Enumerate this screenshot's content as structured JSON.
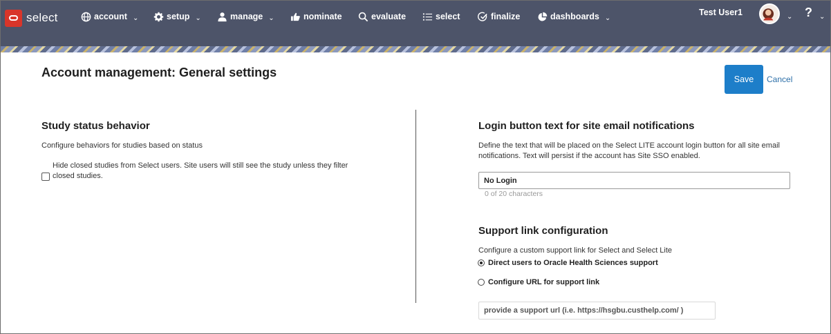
{
  "app": {
    "name": "select",
    "logo_icon": "oracle-logo-icon"
  },
  "nav": {
    "items": [
      {
        "key": "account",
        "label": "account",
        "icon": "globe-icon",
        "dropdown": true
      },
      {
        "key": "setup",
        "label": "setup",
        "icon": "gear-icon",
        "dropdown": true
      },
      {
        "key": "manage",
        "label": "manage",
        "icon": "person-icon",
        "dropdown": true
      },
      {
        "key": "nominate",
        "label": "nominate",
        "icon": "thumbs-up-icon",
        "dropdown": false
      },
      {
        "key": "evaluate",
        "label": "evaluate",
        "icon": "search-icon",
        "dropdown": false
      },
      {
        "key": "select",
        "label": "select",
        "icon": "list-icon",
        "dropdown": false
      },
      {
        "key": "finalize",
        "label": "finalize",
        "icon": "check-circle-icon",
        "dropdown": false
      },
      {
        "key": "dashboards",
        "label": "dashboards",
        "icon": "pie-chart-icon",
        "dropdown": true
      }
    ],
    "user_name": "Test User1",
    "help_label": "?"
  },
  "page": {
    "title": "Account management: General settings",
    "save_label": "Save",
    "cancel_label": "Cancel"
  },
  "study_status": {
    "heading": "Study status behavior",
    "description": "Configure behaviors for studies based on status",
    "hide_closed_label": "Hide closed studies from Select users. Site users will still see the study unless they filter closed studies.",
    "hide_closed_checked": false
  },
  "login_button": {
    "heading": "Login button text for site email notifications",
    "description": "Define the text that will be placed on the Select LITE account login button for all site email notifications. Text will persist if the account has Site SSO enabled.",
    "value": "No Login",
    "counter": "0 of 20 characters"
  },
  "support_link": {
    "heading": "Support link configuration",
    "description": "Configure a custom support link for Select and Select Lite",
    "option_oracle": "Direct users to Oracle Health Sciences support",
    "option_custom": "Configure URL for support link",
    "selected": "oracle",
    "url_placeholder": "provide a support url (i.e. https://hsgbu.custhelp.com/ )"
  },
  "colors": {
    "nav_bg": "#4d5469",
    "accent": "#1d7ec9",
    "brand_red": "#d9352a"
  }
}
